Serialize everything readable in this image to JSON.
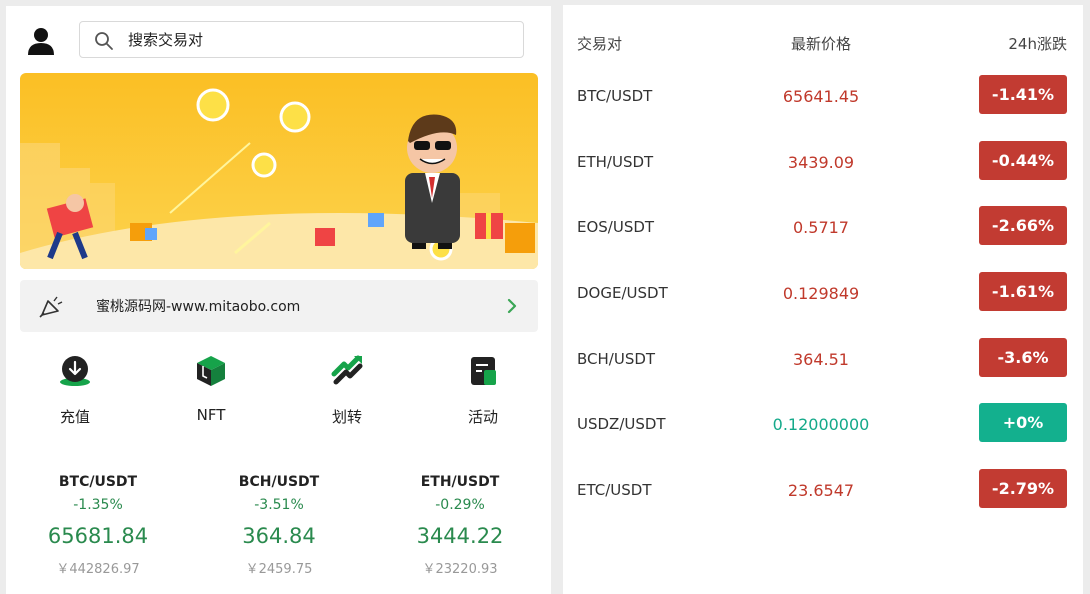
{
  "search": {
    "placeholder": "搜索交易对"
  },
  "notice": {
    "text": "蜜桃源码网-www.mitaobo.com"
  },
  "quick_menu": [
    {
      "label": "充值",
      "icon": "deposit-icon"
    },
    {
      "label": "NFT",
      "icon": "nft-cube-icon"
    },
    {
      "label": "划转",
      "icon": "transfer-icon"
    },
    {
      "label": "活动",
      "icon": "activity-icon"
    }
  ],
  "tickers": [
    {
      "pair": "BTC/USDT",
      "change": "-1.35%",
      "price": "65681.84",
      "cny": "￥442826.97"
    },
    {
      "pair": "BCH/USDT",
      "change": "-3.51%",
      "price": "364.84",
      "cny": "￥2459.75"
    },
    {
      "pair": "ETH/USDT",
      "change": "-0.29%",
      "price": "3444.22",
      "cny": "￥23220.93"
    }
  ],
  "market": {
    "headers": {
      "pair": "交易对",
      "price": "最新价格",
      "change": "24h涨跌"
    },
    "rows": [
      {
        "pair": "BTC/USDT",
        "price": "65641.45",
        "change": "-1.41%",
        "trend": "down"
      },
      {
        "pair": "ETH/USDT",
        "price": "3439.09",
        "change": "-0.44%",
        "trend": "down"
      },
      {
        "pair": "EOS/USDT",
        "price": "0.5717",
        "change": "-2.66%",
        "trend": "down"
      },
      {
        "pair": "DOGE/USDT",
        "price": "0.129849",
        "change": "-1.61%",
        "trend": "down"
      },
      {
        "pair": "BCH/USDT",
        "price": "364.51",
        "change": "-3.6%",
        "trend": "down"
      },
      {
        "pair": "USDZ/USDT",
        "price": "0.12000000",
        "change": "+0%",
        "trend": "up"
      },
      {
        "pair": "ETC/USDT",
        "price": "23.6547",
        "change": "-2.79%",
        "trend": "down"
      }
    ]
  },
  "colors": {
    "down": "#c23b32",
    "up": "#13b08e",
    "banner": "#fbc02d"
  }
}
